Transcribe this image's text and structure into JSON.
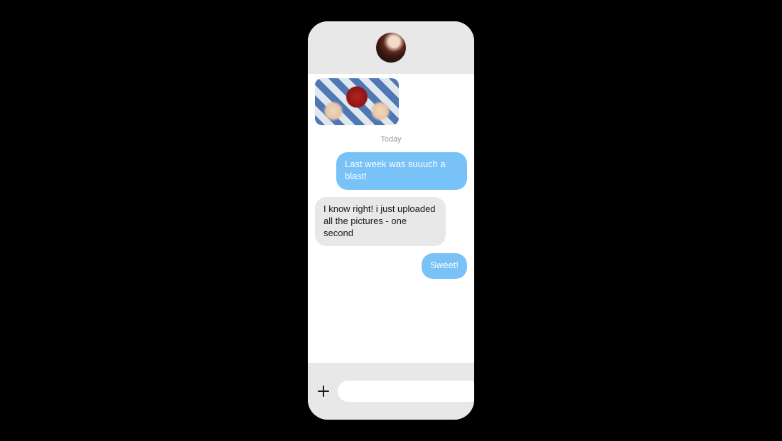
{
  "chat": {
    "date_separator": "Today",
    "messages": [
      {
        "side": "sent",
        "text": "Last week was suuuch a blast!"
      },
      {
        "side": "recv",
        "text": "I know right! i just uploaded all the pictures - one second"
      },
      {
        "side": "sent",
        "text": "Sweet!"
      }
    ]
  },
  "composer": {
    "placeholder": ""
  },
  "icons": {
    "avatar": "contact-avatar",
    "plus": "plus-icon",
    "send": "send-icon"
  },
  "colors": {
    "sent_bubble": "#78c2f8",
    "recv_bubble": "#e8e8e8",
    "phone_chrome": "#e8e8e8",
    "bg": "#000000"
  }
}
